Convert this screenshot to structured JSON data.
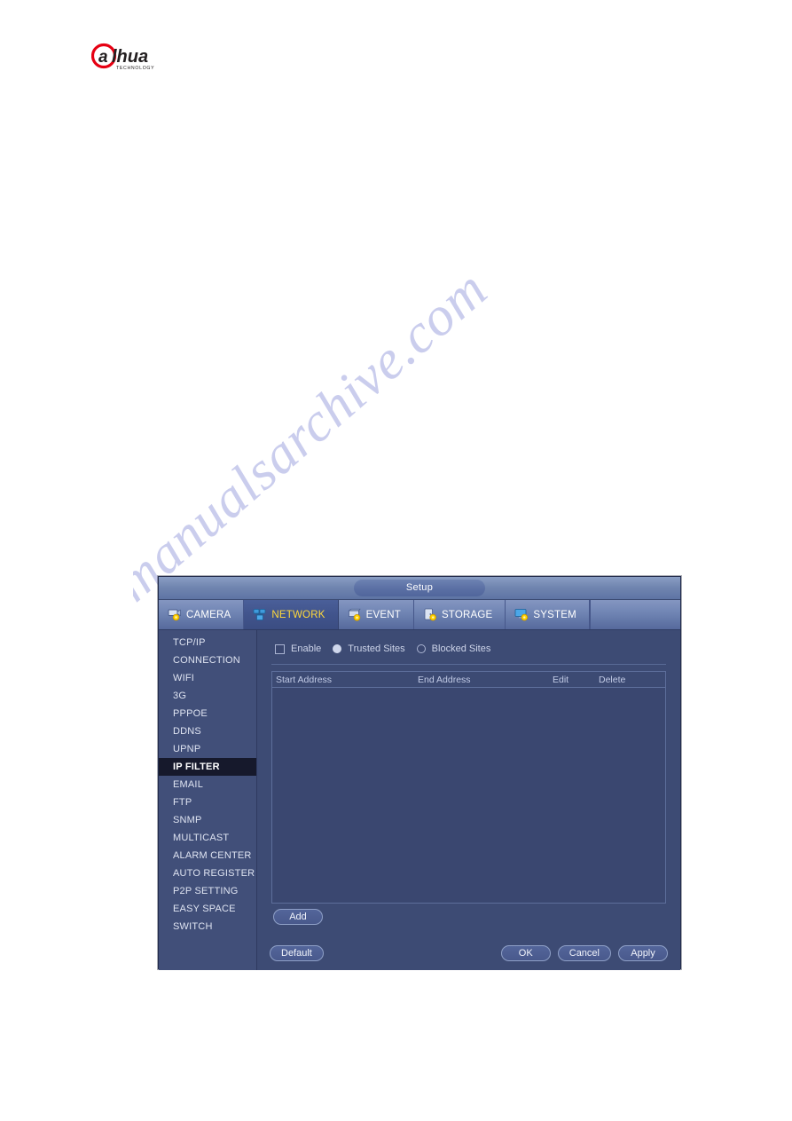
{
  "brand": {
    "logo_text": "alhua",
    "logo_sub": "TECHNOLOGY",
    "logo_red": "#e60012",
    "logo_dark": "#231f20"
  },
  "watermark": {
    "text": "manualsarchive.com",
    "color": "#b9bde8"
  },
  "window": {
    "title": "Setup",
    "accent_color": "#ffd93b",
    "tabs": [
      {
        "label": "CAMERA",
        "icon": "camera-gear-icon",
        "active": false
      },
      {
        "label": "NETWORK",
        "icon": "network-gear-icon",
        "active": true
      },
      {
        "label": "EVENT",
        "icon": "event-gear-icon",
        "active": false
      },
      {
        "label": "STORAGE",
        "icon": "storage-gear-icon",
        "active": false
      },
      {
        "label": "SYSTEM",
        "icon": "system-gear-icon",
        "active": false
      }
    ],
    "sidebar": {
      "selected": "IP FILTER",
      "items": [
        {
          "label": "TCP/IP"
        },
        {
          "label": "CONNECTION"
        },
        {
          "label": "WIFI"
        },
        {
          "label": "3G"
        },
        {
          "label": "PPPOE"
        },
        {
          "label": "DDNS"
        },
        {
          "label": "UPNP"
        },
        {
          "label": "IP FILTER"
        },
        {
          "label": "EMAIL"
        },
        {
          "label": "FTP"
        },
        {
          "label": "SNMP"
        },
        {
          "label": "MULTICAST"
        },
        {
          "label": "ALARM CENTER"
        },
        {
          "label": "AUTO REGISTER"
        },
        {
          "label": "P2P SETTING"
        },
        {
          "label": "EASY SPACE"
        },
        {
          "label": "SWITCH"
        }
      ]
    },
    "ip_filter": {
      "enable_label": "Enable",
      "enable_checked": false,
      "mode_selected": "Trusted Sites",
      "trusted_label": "Trusted Sites",
      "blocked_label": "Blocked Sites",
      "table": {
        "columns": [
          "Start Address",
          "End Address",
          "Edit",
          "Delete"
        ],
        "rows": []
      },
      "add_label": "Add"
    },
    "footer": {
      "default_label": "Default",
      "ok_label": "OK",
      "cancel_label": "Cancel",
      "apply_label": "Apply"
    }
  }
}
